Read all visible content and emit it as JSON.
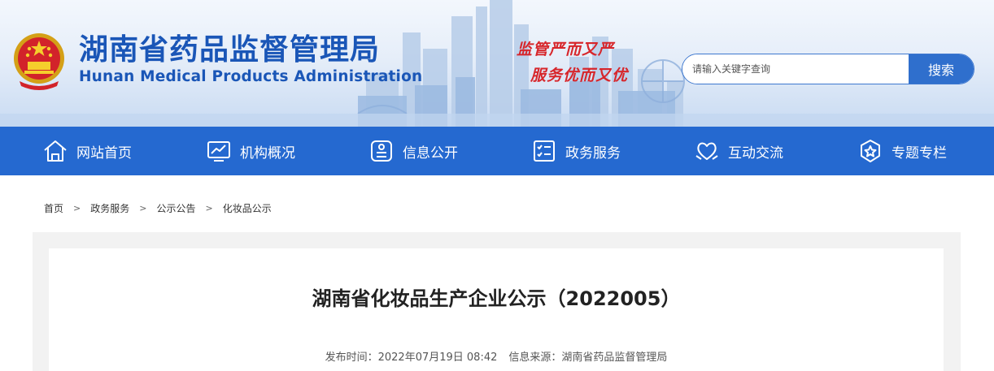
{
  "header": {
    "title_cn": "湖南省药品监督管理局",
    "title_en": "Hunan Medical Products Administration",
    "slogan_line1": "监管严而又严",
    "slogan_line2": "服务优而又优",
    "emblem_icon": "national-emblem-icon"
  },
  "search": {
    "placeholder": "请输入关键字查询",
    "button_label": "搜索"
  },
  "nav": {
    "items": [
      {
        "label": "网站首页",
        "icon": "home-icon"
      },
      {
        "label": "机构概况",
        "icon": "chart-monitor-icon"
      },
      {
        "label": "信息公开",
        "icon": "document-list-icon"
      },
      {
        "label": "政务服务",
        "icon": "checklist-icon"
      },
      {
        "label": "互动交流",
        "icon": "heart-hands-icon"
      },
      {
        "label": "专题专栏",
        "icon": "star-badge-icon"
      }
    ]
  },
  "breadcrumb": {
    "items": [
      "首页",
      "政务服务",
      "公示公告",
      "化妆品公示"
    ],
    "separator": ">"
  },
  "article": {
    "title": "湖南省化妆品生产企业公示（2022005）",
    "publish_label": "发布时间：2022年07月19日 08:42",
    "source_label": "信息来源：湖南省药品监督管理局"
  },
  "colors": {
    "brand_blue": "#2569d0",
    "title_blue": "#1a56b7",
    "slogan_red": "#d7262b"
  }
}
